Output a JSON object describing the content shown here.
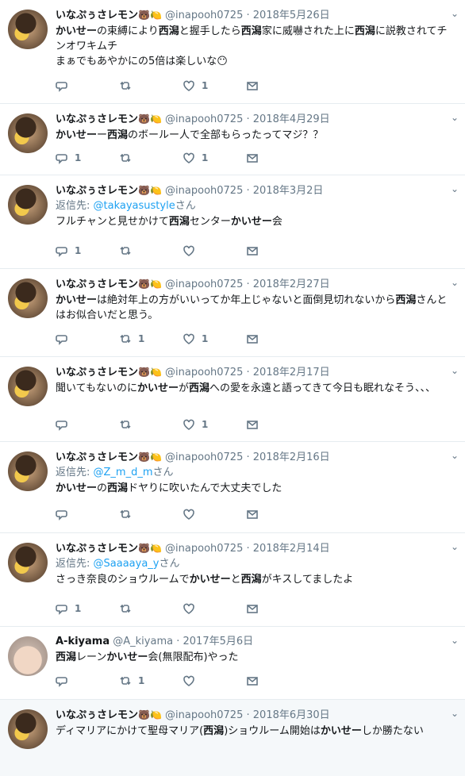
{
  "tweets": [
    {
      "name": "いなぷぅさレモン",
      "emoji": "🐻🍋",
      "handle": "@inapooh0725",
      "dot": "·",
      "date": "2018年5月26日",
      "reply_to": null,
      "text_parts": [
        {
          "t": "かいせー",
          "b": true
        },
        {
          "t": "の束縛により",
          "b": false
        },
        {
          "t": "西潟",
          "b": true
        },
        {
          "t": "と握手したら",
          "b": false
        },
        {
          "t": "西潟",
          "b": true
        },
        {
          "t": "家に威嚇された上に",
          "b": false
        },
        {
          "t": "西潟",
          "b": true
        },
        {
          "t": "に説教されてチンオワキムチ\nまぁでもあやかにの5倍は楽しいな😶",
          "b": false
        }
      ],
      "counts": {
        "reply": "",
        "retweet": "",
        "like": "1"
      }
    },
    {
      "name": "いなぷぅさレモン",
      "emoji": "🐻🍋",
      "handle": "@inapooh0725",
      "dot": "·",
      "date": "2018年4月29日",
      "reply_to": null,
      "text_parts": [
        {
          "t": "かいせー",
          "b": true
        },
        {
          "t": "ー",
          "b": false
        },
        {
          "t": "西潟",
          "b": true
        },
        {
          "t": "のボールー人で全部もらったってマジ？？",
          "b": false
        }
      ],
      "counts": {
        "reply": "1",
        "retweet": "",
        "like": "1"
      }
    },
    {
      "name": "いなぷぅさレモン",
      "emoji": "🐻🍋",
      "handle": "@inapooh0725",
      "dot": "·",
      "date": "2018年3月2日",
      "reply_to": {
        "label": "返信先: ",
        "user": "@takayasustyle",
        "suffix": "さん"
      },
      "text_parts": [
        {
          "t": "フルチャンと見せかけて",
          "b": false
        },
        {
          "t": "西潟",
          "b": true
        },
        {
          "t": "センター",
          "b": false
        },
        {
          "t": "かいせー",
          "b": true
        },
        {
          "t": "会",
          "b": false
        }
      ],
      "counts": {
        "reply": "1",
        "retweet": "",
        "like": ""
      }
    },
    {
      "name": "いなぷぅさレモン",
      "emoji": "🐻🍋",
      "handle": "@inapooh0725",
      "dot": "·",
      "date": "2018年2月27日",
      "reply_to": null,
      "text_parts": [
        {
          "t": "かいせー",
          "b": true
        },
        {
          "t": "は絶対年上の方がいいってか年上じゃないと面倒見切れないから",
          "b": false
        },
        {
          "t": "西潟",
          "b": true
        },
        {
          "t": "さんとはお似合いだと思う。",
          "b": false
        }
      ],
      "counts": {
        "reply": "",
        "retweet": "1",
        "like": "1"
      }
    },
    {
      "name": "いなぷぅさレモン",
      "emoji": "🐻🍋",
      "handle": "@inapooh0725",
      "dot": "·",
      "date": "2018年2月17日",
      "reply_to": null,
      "text_parts": [
        {
          "t": "聞いてもないのに",
          "b": false
        },
        {
          "t": "かいせー",
          "b": true
        },
        {
          "t": "が",
          "b": false
        },
        {
          "t": "西潟",
          "b": true
        },
        {
          "t": "への愛を永遠と語ってきて今日も眠れなそう、、、",
          "b": false
        }
      ],
      "counts": {
        "reply": "",
        "retweet": "",
        "like": "1"
      }
    },
    {
      "name": "いなぷぅさレモン",
      "emoji": "🐻🍋",
      "handle": "@inapooh0725",
      "dot": "·",
      "date": "2018年2月16日",
      "reply_to": {
        "label": "返信先: ",
        "user": "@Z_m_d_m",
        "suffix": "さん"
      },
      "text_parts": [
        {
          "t": "かいせー",
          "b": true
        },
        {
          "t": "の",
          "b": false
        },
        {
          "t": "西潟",
          "b": true
        },
        {
          "t": "ドヤりに吹いたんで大丈夫でした",
          "b": false
        }
      ],
      "counts": {
        "reply": "",
        "retweet": "",
        "like": ""
      }
    },
    {
      "name": "いなぷぅさレモン",
      "emoji": "🐻🍋",
      "handle": "@inapooh0725",
      "dot": "·",
      "date": "2018年2月14日",
      "reply_to": {
        "label": "返信先: ",
        "user": "@Saaaaya_y",
        "suffix": "さん"
      },
      "text_parts": [
        {
          "t": "さっき奈良のショウルームで",
          "b": false
        },
        {
          "t": "かいせー",
          "b": true
        },
        {
          "t": "と",
          "b": false
        },
        {
          "t": "西潟",
          "b": true
        },
        {
          "t": "がキスしてましたよ",
          "b": false
        }
      ],
      "counts": {
        "reply": "1",
        "retweet": "",
        "like": ""
      }
    },
    {
      "name": "A-kiyama",
      "emoji": "",
      "handle": "@A_kiyama",
      "dot": "·",
      "date": "2017年5月6日",
      "reply_to": null,
      "text_parts": [
        {
          "t": "西潟",
          "b": true
        },
        {
          "t": "レーン",
          "b": false
        },
        {
          "t": "かいせー",
          "b": true
        },
        {
          "t": "会(無限配布)やった",
          "b": false
        }
      ],
      "counts": {
        "reply": "",
        "retweet": "1",
        "like": ""
      }
    },
    {
      "name": "いなぷぅさレモン",
      "emoji": "🐻🍋",
      "handle": "@inapooh0725",
      "dot": "·",
      "date": "2018年6月30日",
      "reply_to": null,
      "text_parts": [
        {
          "t": "ディマリアにかけて聖母マリア(",
          "b": false
        },
        {
          "t": "西潟",
          "b": true
        },
        {
          "t": ")ショウルーム開始は",
          "b": false
        },
        {
          "t": "かいせー",
          "b": true
        },
        {
          "t": "しか勝たない",
          "b": false
        }
      ],
      "counts": {
        "reply": "",
        "retweet": "",
        "like": ""
      },
      "no_actions": true
    }
  ]
}
